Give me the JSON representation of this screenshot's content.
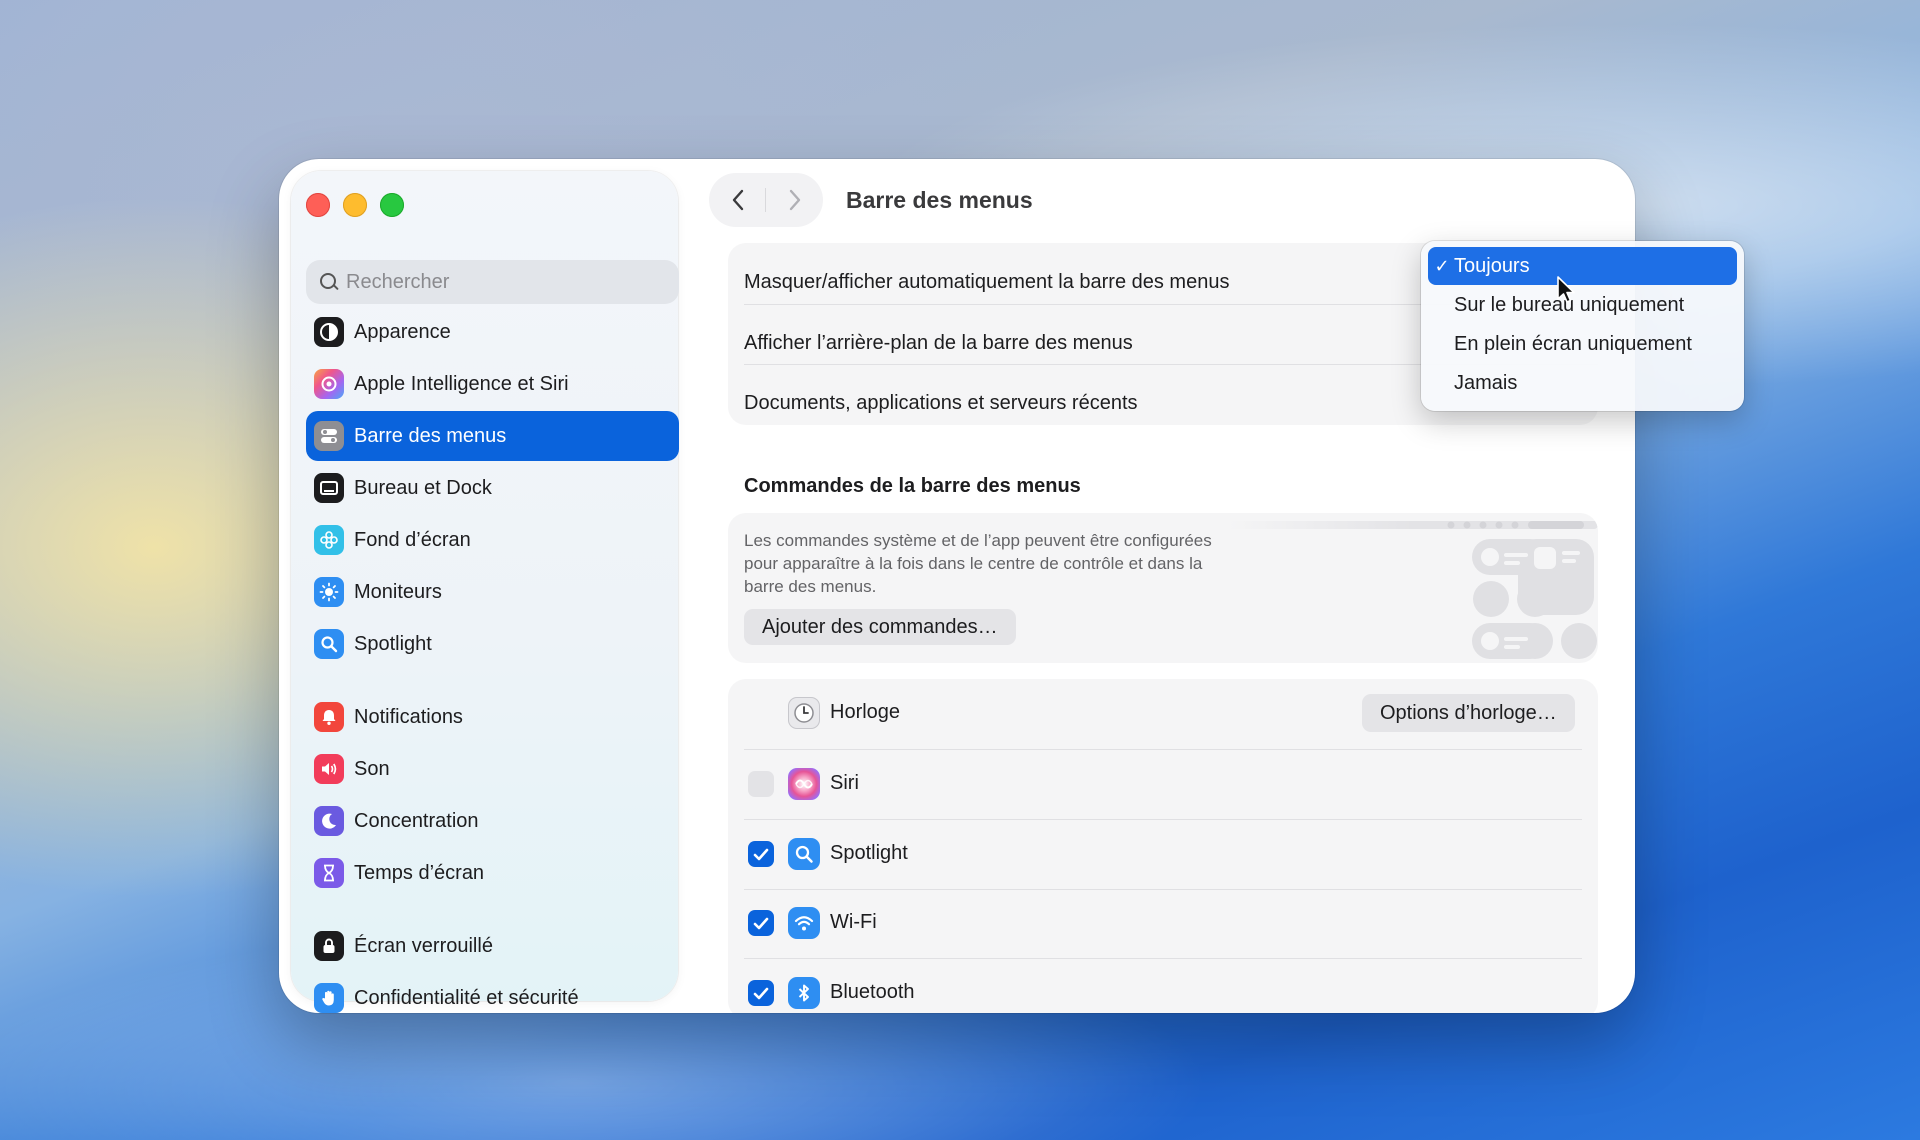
{
  "window": {
    "title": "Barre des menus"
  },
  "sidebar": {
    "search_placeholder": "Rechercher",
    "items": [
      {
        "label": "Apparence",
        "icon": "appearance-icon",
        "active": false
      },
      {
        "label": "Apple Intelligence et Siri",
        "icon": "apple-intelligence-icon",
        "active": false
      },
      {
        "label": "Barre des menus",
        "icon": "menu-bar-icon",
        "active": true
      },
      {
        "label": "Bureau et Dock",
        "icon": "desktop-dock-icon",
        "active": false
      },
      {
        "label": "Fond d’écran",
        "icon": "wallpaper-icon",
        "active": false
      },
      {
        "label": "Moniteurs",
        "icon": "displays-icon",
        "active": false
      },
      {
        "label": "Spotlight",
        "icon": "spotlight-icon",
        "active": false
      },
      {
        "label": "Notifications",
        "icon": "notifications-icon",
        "active": false
      },
      {
        "label": "Son",
        "icon": "sound-icon",
        "active": false
      },
      {
        "label": "Concentration",
        "icon": "focus-icon",
        "active": false
      },
      {
        "label": "Temps d’écran",
        "icon": "screen-time-icon",
        "active": false
      },
      {
        "label": "Écran verrouillé",
        "icon": "lock-screen-icon",
        "active": false
      },
      {
        "label": "Confidentialité et sécurité",
        "icon": "privacy-hand-icon",
        "active": false
      }
    ]
  },
  "main": {
    "settings_rows": [
      {
        "label": "Masquer/afficher automatiquement la barre des menus"
      },
      {
        "label": "Afficher l’arrière-plan de la barre des menus"
      },
      {
        "label": "Documents, applications et serveurs récents"
      }
    ],
    "controls_section": {
      "title": "Commandes de la barre des menus",
      "description": "Les commandes système et de l’app peuvent être configurées pour apparaître à la fois dans le centre de contrôle et dans la barre des menus.",
      "add_button": "Ajouter des commandes…"
    },
    "menu_bar_items": [
      {
        "label": "Horloge",
        "checkbox": null,
        "icon": "clock-icon",
        "button": "Options d’horloge…"
      },
      {
        "label": "Siri",
        "checkbox": false,
        "icon": "siri-icon"
      },
      {
        "label": "Spotlight",
        "checkbox": true,
        "icon": "spotlight-icon"
      },
      {
        "label": "Wi-Fi",
        "checkbox": true,
        "icon": "wifi-icon"
      },
      {
        "label": "Bluetooth",
        "checkbox": true,
        "icon": "bluetooth-icon"
      }
    ]
  },
  "dropdown": {
    "options": [
      {
        "label": "Toujours",
        "selected": true
      },
      {
        "label": "Sur le bureau uniquement",
        "selected": false
      },
      {
        "label": "En plein écran uniquement",
        "selected": false
      },
      {
        "label": "Jamais",
        "selected": false
      }
    ],
    "check_glyph": "✓"
  },
  "colors": {
    "accent": "#0a63dc",
    "menu_highlight": "#1e6fe6",
    "traffic_red": "#fe5f57",
    "traffic_yellow": "#febc2e",
    "traffic_green": "#28c840"
  }
}
